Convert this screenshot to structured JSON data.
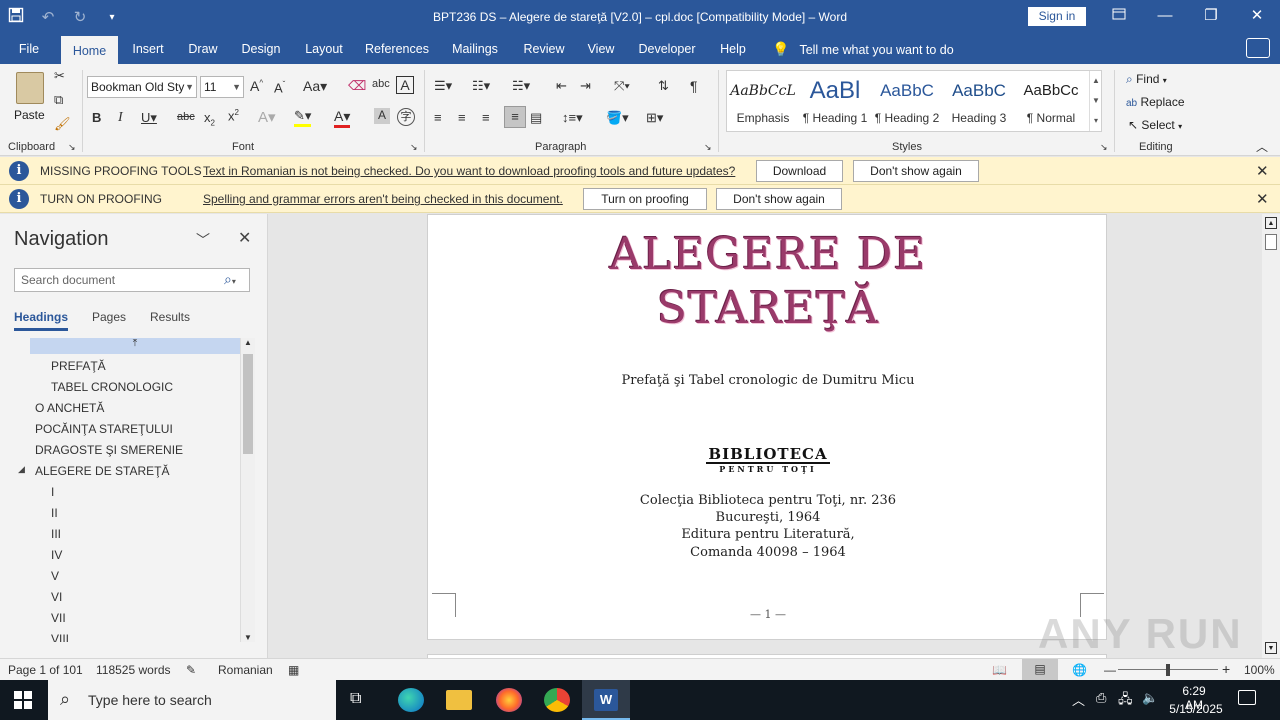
{
  "window": {
    "title": "BPT236 DS – Alegere de stareţă [V2.0] – cpl.doc [Compatibility Mode] – Word",
    "sign_in": "Sign in"
  },
  "tabs": [
    "File",
    "Home",
    "Insert",
    "Draw",
    "Design",
    "Layout",
    "References",
    "Mailings",
    "Review",
    "View",
    "Developer",
    "Help"
  ],
  "tell_me": "Tell me what you want to do",
  "ribbon": {
    "paste": "Paste",
    "clipboard": "Clipboard",
    "font_group": "Font",
    "paragraph_group": "Paragraph",
    "styles_group": "Styles",
    "editing_group": "Editing",
    "font_name": "Bookman Old Sty",
    "font_size": "11",
    "styles": [
      {
        "preview": "AaBbCcL",
        "name": "Emphasis"
      },
      {
        "preview": "AaBl",
        "name": "¶ Heading 1"
      },
      {
        "preview": "AaBbC",
        "name": "¶ Heading 2"
      },
      {
        "preview": "AaBbC",
        "name": "Heading 3"
      },
      {
        "preview": "AaBbCc",
        "name": "¶ Normal"
      }
    ],
    "find": "Find",
    "replace": "Replace",
    "select": "Select"
  },
  "bars": [
    {
      "title": "MISSING PROOFING TOOLS",
      "message": "Text in Romanian is not being checked. Do you want to download proofing tools and future updates?",
      "button1": "Download",
      "button2": "Don't show again"
    },
    {
      "title": "TURN ON PROOFING",
      "message": "Spelling and grammar errors aren't being checked in this document.",
      "button1": "Turn on proofing",
      "button2": "Don't show again"
    }
  ],
  "navigation": {
    "title": "Navigation",
    "search_placeholder": "Search document",
    "tabs": [
      "Headings",
      "Pages",
      "Results"
    ],
    "items": [
      "PREFAŢĂ",
      "TABEL CRONOLOGIC",
      "O ANCHETĂ",
      "POCĂINŢA STAREŢULUI",
      "DRAGOSTE ŞI SMERENIE",
      "ALEGERE DE STAREŢĂ",
      "I",
      "II",
      "III",
      "IV",
      "V",
      "VI",
      "VII",
      "VIII"
    ]
  },
  "document": {
    "title_line1": "ALEGERE DE",
    "title_line2": "STAREŢĂ",
    "subtitle": "Prefaţă şi Tabel cronologic de Dumitru Micu",
    "logo_line1": "BIBLIOTECA",
    "logo_line2": "PENTRU TOŢI",
    "info": [
      "Colecţia Biblioteca pentru Toţi, nr. 236",
      "Bucureşti, 1964",
      "Editura pentru Literatură,",
      "Comanda 40098 – 1964"
    ],
    "page_num": "— 1 —"
  },
  "status": {
    "page": "Page 1 of 101",
    "words": "118525 words",
    "language": "Romanian",
    "zoom": "100%"
  },
  "taskbar": {
    "search": "Type here to search",
    "time": "6:29 AM",
    "date": "5/15/2025"
  },
  "watermark": "ANY RUN"
}
